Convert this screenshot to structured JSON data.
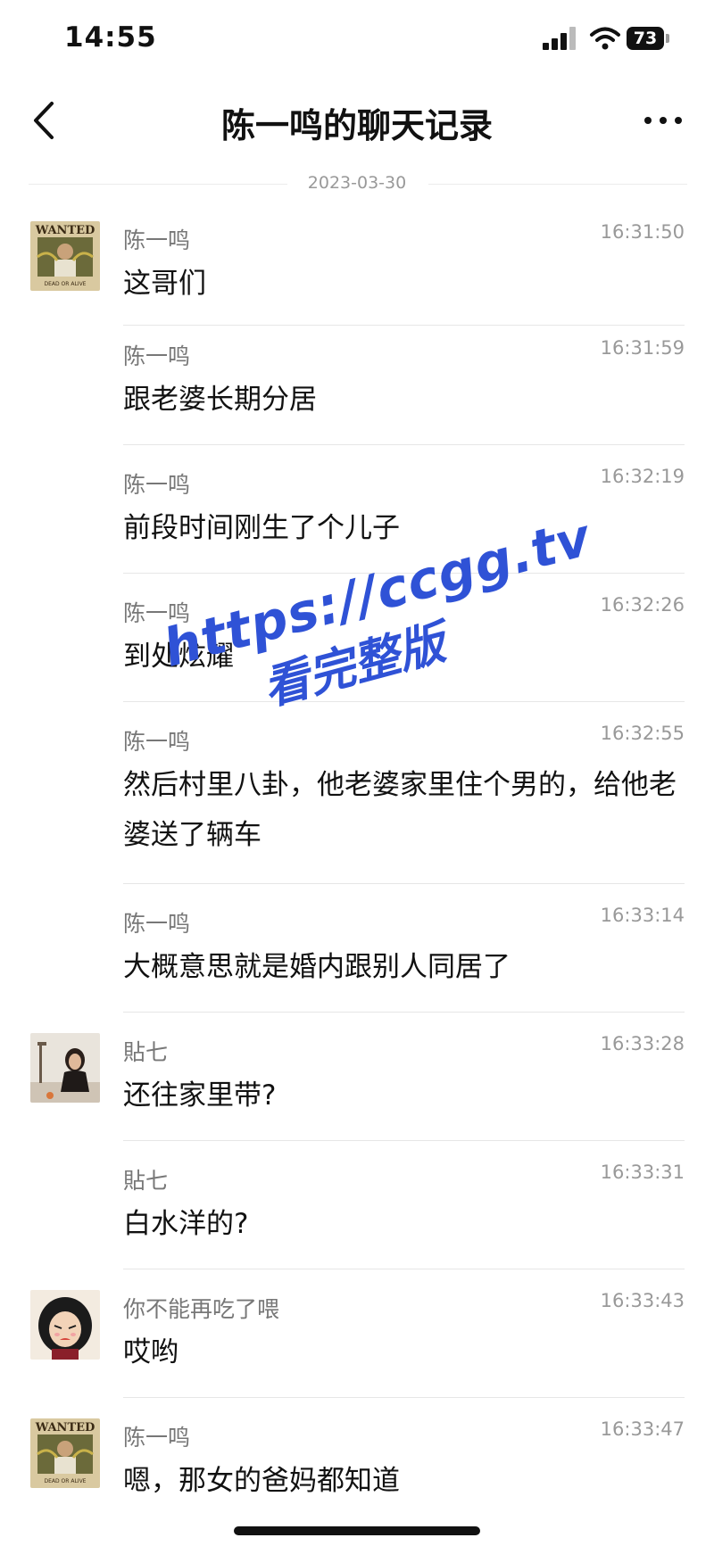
{
  "status_bar": {
    "time": "14:55",
    "battery": "73"
  },
  "nav": {
    "title": "陈一鸣的聊天记录"
  },
  "date_separator": "2023-03-30",
  "messages": [
    {
      "sender": "陈一鸣",
      "time": "16:31:50",
      "text": "这哥们"
    },
    {
      "sender": "陈一鸣",
      "time": "16:31:59",
      "text": "跟老婆长期分居"
    },
    {
      "sender": "陈一鸣",
      "time": "16:32:19",
      "text": "前段时间刚生了个儿子"
    },
    {
      "sender": "陈一鸣",
      "time": "16:32:26",
      "text": "到处炫耀"
    },
    {
      "sender": "陈一鸣",
      "time": "16:32:55",
      "text": "然后村里八卦，他老婆家里住个男的，给他老婆送了辆车"
    },
    {
      "sender": "陈一鸣",
      "time": "16:33:14",
      "text": "大概意思就是婚内跟别人同居了"
    },
    {
      "sender": "貼七",
      "time": "16:33:28",
      "text": "还往家里带?"
    },
    {
      "sender": "貼七",
      "time": "16:33:31",
      "text": "白水洋的?"
    },
    {
      "sender": "你不能再吃了喂",
      "time": "16:33:43",
      "text": "哎哟"
    },
    {
      "sender": "陈一鸣",
      "time": "16:33:47",
      "text": "嗯，那女的爸妈都知道"
    }
  ],
  "avatars": {
    "wanted_poster": "WANTED",
    "wanted_caption": "DEAD OR ALIVE"
  },
  "watermark": {
    "line1": "https://ccgg.tv",
    "line2": "看完整版"
  }
}
